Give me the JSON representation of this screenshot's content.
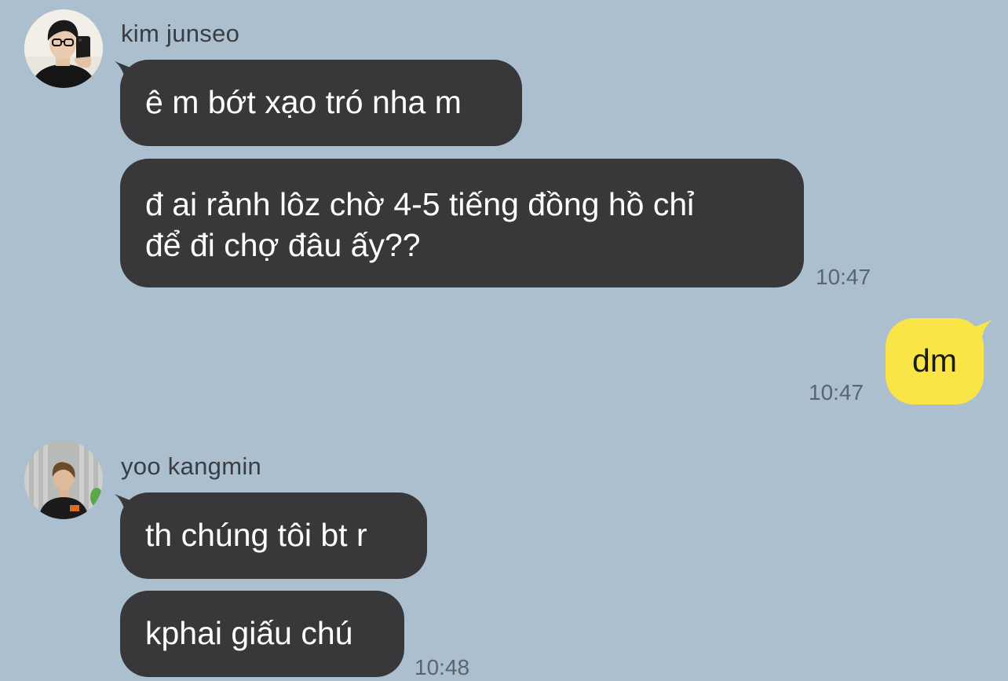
{
  "colors": {
    "background": "#abbfcf",
    "incoming_bubble": "#38383b",
    "outgoing_bubble": "#f9e547",
    "incoming_text": "#ffffff",
    "outgoing_text": "#1a1a1a"
  },
  "messages": {
    "group1": {
      "sender": "kim junseo",
      "bubble1": "ê m bớt xạo tró nha m",
      "bubble2_line1": "đ ai rảnh lôz chờ 4-5 tiếng đồng hồ chỉ",
      "bubble2_line2": "để đi chợ đâu ấy??",
      "time": "10:47"
    },
    "outgoing1": {
      "text": "dm",
      "time": "10:47"
    },
    "group2": {
      "sender": "yoo kangmin",
      "bubble1": "th chúng tôi bt r",
      "bubble2": "kphai giấu chú",
      "time": "10:48"
    }
  }
}
